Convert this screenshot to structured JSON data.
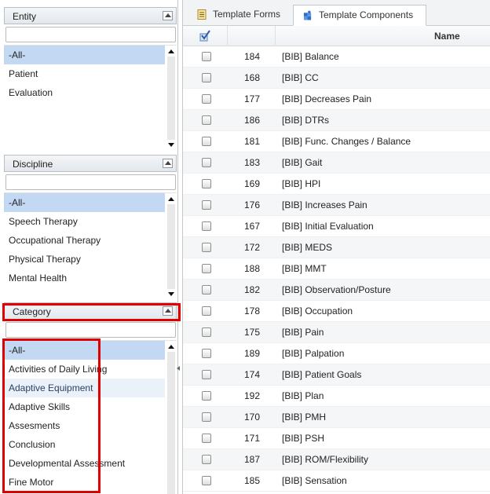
{
  "filters": {
    "entity": {
      "title": "Entity",
      "search_value": "",
      "items": [
        "-All-",
        "Patient",
        "Evaluation"
      ]
    },
    "discipline": {
      "title": "Discipline",
      "search_value": "",
      "items": [
        "-All-",
        "Speech Therapy",
        "Occupational Therapy",
        "Physical Therapy",
        "Mental Health"
      ]
    },
    "category": {
      "title": "Category",
      "search_value": "",
      "items": [
        "-All-",
        "Activities of Daily Living",
        "Adaptive Equipment",
        "Adaptive Skills",
        "Assesments",
        "Conclusion",
        "Developmental Assessment",
        "Fine Motor"
      ]
    }
  },
  "tabs": [
    {
      "label": "Template Forms",
      "icon": "document-icon"
    },
    {
      "label": "Template Components",
      "icon": "puzzle-icon",
      "active": true
    }
  ],
  "grid": {
    "header": {
      "name": "Name",
      "select_icon": "check-all-icon"
    },
    "rows": [
      {
        "id": "184",
        "name": "[BIB] Balance"
      },
      {
        "id": "168",
        "name": "[BIB] CC"
      },
      {
        "id": "177",
        "name": "[BIB] Decreases Pain"
      },
      {
        "id": "186",
        "name": "[BIB] DTRs"
      },
      {
        "id": "181",
        "name": "[BIB] Func. Changes / Balance"
      },
      {
        "id": "183",
        "name": "[BIB] Gait"
      },
      {
        "id": "169",
        "name": "[BIB] HPI"
      },
      {
        "id": "176",
        "name": "[BIB] Increases Pain"
      },
      {
        "id": "167",
        "name": "[BIB] Initial Evaluation"
      },
      {
        "id": "172",
        "name": "[BIB] MEDS"
      },
      {
        "id": "188",
        "name": "[BIB] MMT"
      },
      {
        "id": "182",
        "name": "[BIB] Observation/Posture"
      },
      {
        "id": "178",
        "name": "[BIB] Occupation"
      },
      {
        "id": "175",
        "name": "[BIB] Pain"
      },
      {
        "id": "189",
        "name": "[BIB] Palpation"
      },
      {
        "id": "174",
        "name": "[BIB] Patient Goals"
      },
      {
        "id": "192",
        "name": "[BIB] Plan"
      },
      {
        "id": "170",
        "name": "[BIB] PMH"
      },
      {
        "id": "171",
        "name": "[BIB] PSH"
      },
      {
        "id": "187",
        "name": "[BIB] ROM/Flexibility"
      },
      {
        "id": "185",
        "name": "[BIB] Sensation"
      }
    ]
  },
  "colors": {
    "selected_row": "#c2d8f3",
    "annotation_red": "#e00000",
    "accent_blue": "#2f6fc6"
  }
}
